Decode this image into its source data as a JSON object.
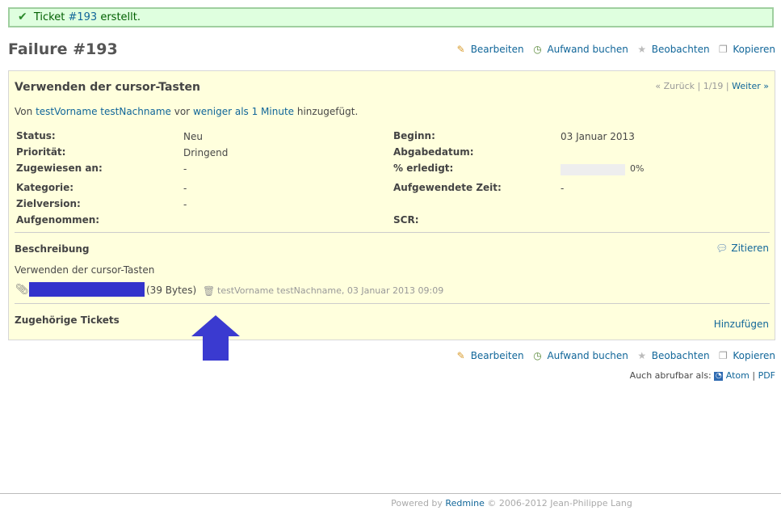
{
  "flash": {
    "prefix": "Ticket",
    "ticket_link": "#193",
    "suffix": "erstellt."
  },
  "title": "Failure #193",
  "toolbar": {
    "edit": "Bearbeiten",
    "log_time": "Aufwand buchen",
    "watch": "Beobachten",
    "copy": "Kopieren"
  },
  "issue": {
    "subject": "Verwenden der cursor-Tasten",
    "nav": {
      "prev": "« Zurück",
      "pos": "1/19",
      "next": "Weiter »"
    },
    "author": {
      "prefix": "Von",
      "name": "testVorname testNachname",
      "mid": "vor",
      "time": "weniger als 1 Minute",
      "suffix": "hinzugefügt."
    },
    "attributes_left": [
      {
        "label": "Status:",
        "value": "Neu"
      },
      {
        "label": "Priorität:",
        "value": "Dringend"
      },
      {
        "label": "Zugewiesen an:",
        "value": "-"
      },
      {
        "label": "Kategorie:",
        "value": "-"
      },
      {
        "label": "Zielversion:",
        "value": "-"
      },
      {
        "label": "Aufgenommen:",
        "value": ""
      }
    ],
    "attributes_right": [
      {
        "label": "Beginn:",
        "value": "03 Januar 2013"
      },
      {
        "label": "Abgabedatum:",
        "value": ""
      },
      {
        "label": "% erledigt:",
        "value": "0%"
      },
      {
        "label": "Aufgewendete Zeit:",
        "value": "-"
      },
      {
        "label": "SCR:",
        "value": ""
      }
    ],
    "done_ratio": 0,
    "description_title": "Beschreibung",
    "quote": "Zitieren",
    "description": "Verwenden der cursor-Tasten",
    "attachment": {
      "size": "(39 Bytes)",
      "author_date": "testVorname testNachname, 03 Januar 2013 09:09"
    },
    "relations_title": "Zugehörige Tickets",
    "add": "Hinzufügen"
  },
  "also_available": {
    "label": "Auch abrufbar als:",
    "atom": "Atom",
    "pdf": "PDF"
  },
  "footer": {
    "powered": "Powered by",
    "redmine": "Redmine",
    "copy": "© 2006-2012 Jean-Philippe Lang"
  },
  "colors": {
    "flash_bg": "#dfffdf",
    "issue_bg": "#ffffdd",
    "link": "#116699",
    "redacted": "#3333cc",
    "arrow": "#3a3ad0"
  }
}
